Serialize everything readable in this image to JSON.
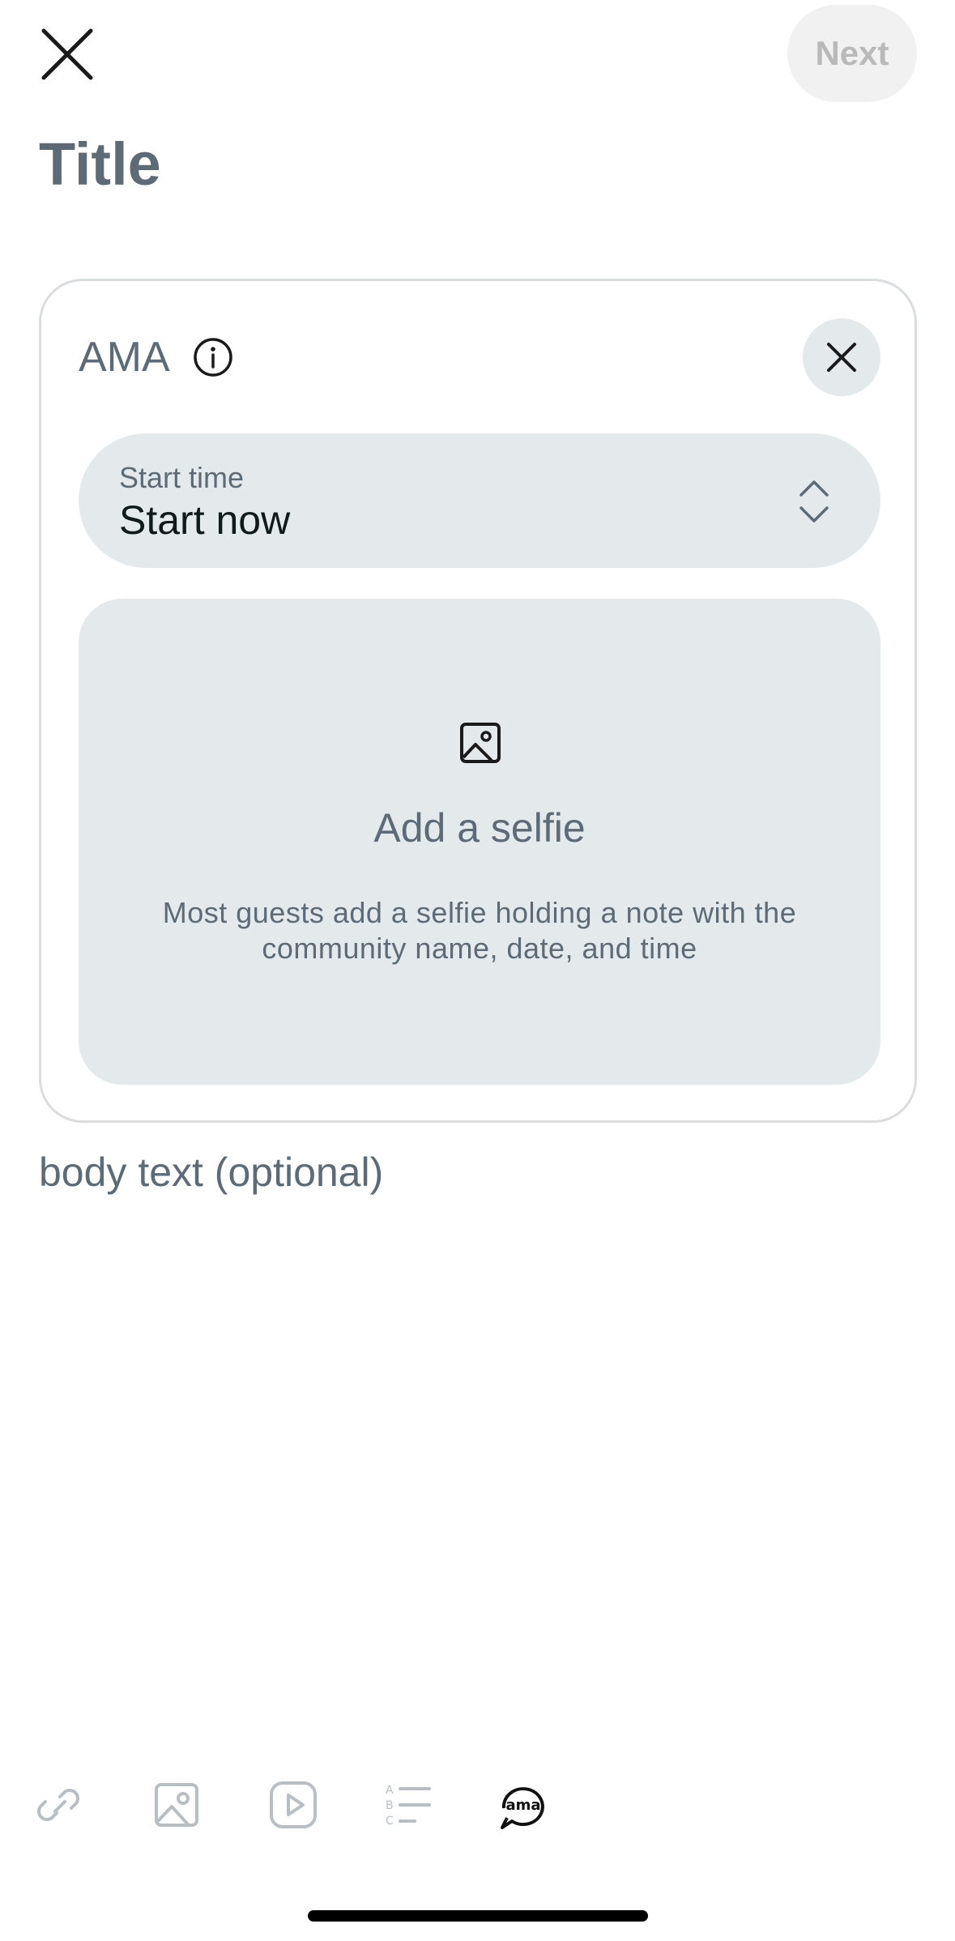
{
  "header": {
    "next_label": "Next",
    "title_placeholder": "Title"
  },
  "ama": {
    "label": "AMA",
    "start_time_label": "Start time",
    "start_time_value": "Start now",
    "selfie_title": "Add a selfie",
    "selfie_description_line1": "Most guests add a selfie holding a note with the",
    "selfie_description_line2": "community name, date, and time"
  },
  "body": {
    "placeholder": "body text (optional)"
  },
  "toolbar": {
    "items": [
      {
        "icon": "link-icon"
      },
      {
        "icon": "image-icon"
      },
      {
        "icon": "video-icon"
      },
      {
        "icon": "poll-icon"
      },
      {
        "icon": "ama-icon",
        "text": "ama"
      }
    ]
  },
  "colors": {
    "accent_gray": "#5c6b75",
    "surface": "#e4eaec",
    "next_disabled_bg": "#f1f1f1",
    "next_disabled_text": "#b9b9b9"
  }
}
